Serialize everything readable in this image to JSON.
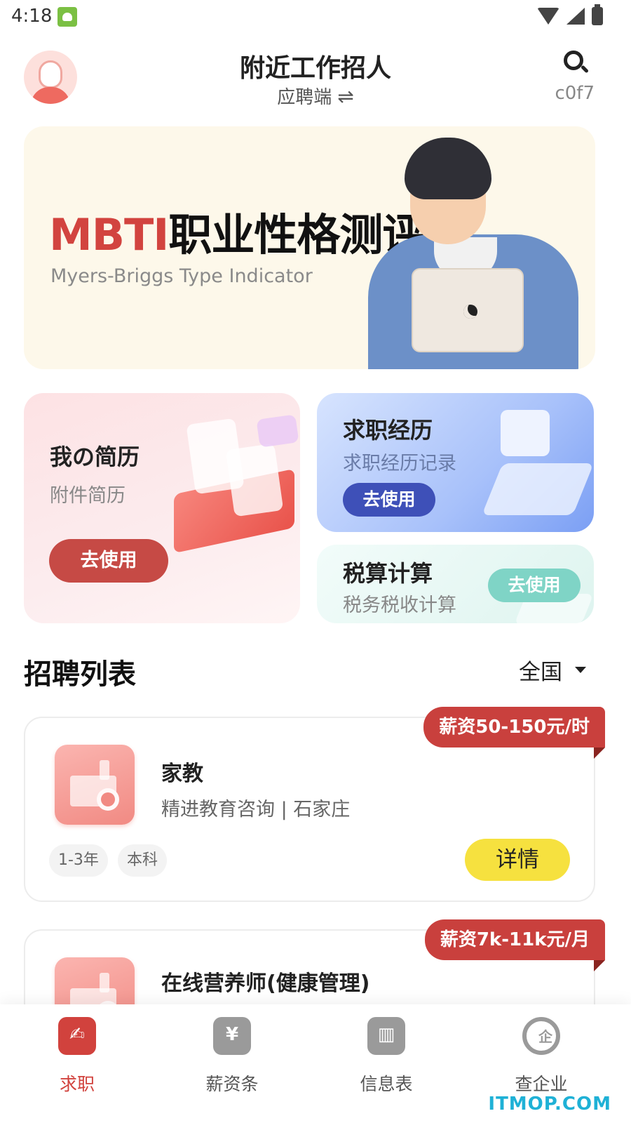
{
  "status_bar": {
    "time": "4:18"
  },
  "header": {
    "title": "附近工作招人",
    "subtitle": "应聘端",
    "swap_glyph": "⇌",
    "code": "c0f7"
  },
  "banner": {
    "title_highlight": "MBTI",
    "title_rest": "职业性格测评",
    "subtitle": "Myers-Briggs Type Indicator"
  },
  "features": {
    "resume": {
      "title": "我の简历",
      "desc": "附件简历",
      "button": "去使用"
    },
    "history": {
      "title": "求职经历",
      "desc": "求职经历记录",
      "button": "去使用"
    },
    "tax": {
      "title": "税算计算",
      "desc": "税务税收计算",
      "button": "去使用"
    }
  },
  "recruit": {
    "title": "招聘列表",
    "region": "全国",
    "jobs": [
      {
        "title": "家教",
        "company": "精进教育咨询 | 石家庄",
        "salary": "薪资50-150元/时",
        "tags": [
          "1-3年",
          "本科"
        ],
        "detail": "详情"
      },
      {
        "title": "在线营养师(健康管理)",
        "salary": "薪资7k-11k元/月"
      }
    ]
  },
  "bottom_nav": {
    "items": [
      {
        "label": "求职",
        "glyph": "✍",
        "icon": "job-icon",
        "active": true
      },
      {
        "label": "薪资条",
        "glyph": "¥",
        "icon": "salary-icon",
        "active": false
      },
      {
        "label": "信息表",
        "glyph": "▥",
        "icon": "info-table-icon",
        "active": false
      },
      {
        "label": "查企业",
        "glyph": "企",
        "icon": "company-search-icon",
        "active": false
      }
    ]
  },
  "watermark": "ITMOP.COM",
  "colors": {
    "accent_red": "#d1423d",
    "button_yellow": "#f6e13f",
    "button_blue": "#3e50b8",
    "button_teal": "#7fd4c6"
  }
}
